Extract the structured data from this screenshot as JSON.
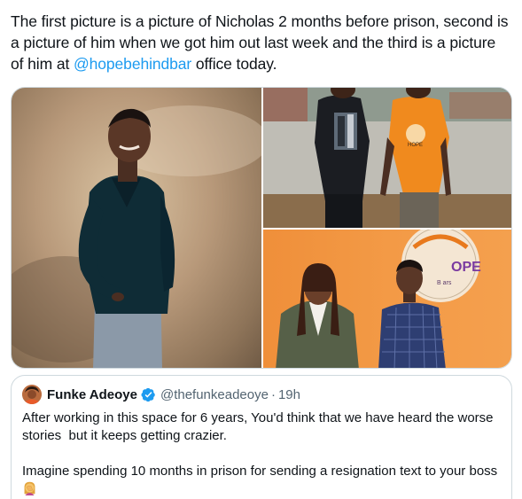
{
  "tweet": {
    "text_part1": "The first picture is a picture of Nicholas 2 months before prison, second is a picture of him when we got him out last week and the third is a picture of him at ",
    "mention": "@hopebehindbar",
    "text_part2": " office today."
  },
  "media": {
    "photo_3_logo_line1": "OPE",
    "photo_3_logo_line2": "B      ars"
  },
  "quoted_tweet": {
    "display_name": "Funke Adeoye",
    "handle": "@thefunkeadeoye",
    "separator": "·",
    "timestamp": "19h",
    "paragraph1": "After working in this space for 6 years, You'd think that we have heard the worse stories  but it keeps getting crazier.",
    "paragraph2": "Imagine spending 10 months in prison for sending a resignation text to your boss",
    "emoji": "woman-facepalming-emoji"
  },
  "colors": {
    "link": "#1d9bf0",
    "verified_badge": "#1d9bf0",
    "secondary_text": "#536471",
    "border": "#cfd9de"
  }
}
